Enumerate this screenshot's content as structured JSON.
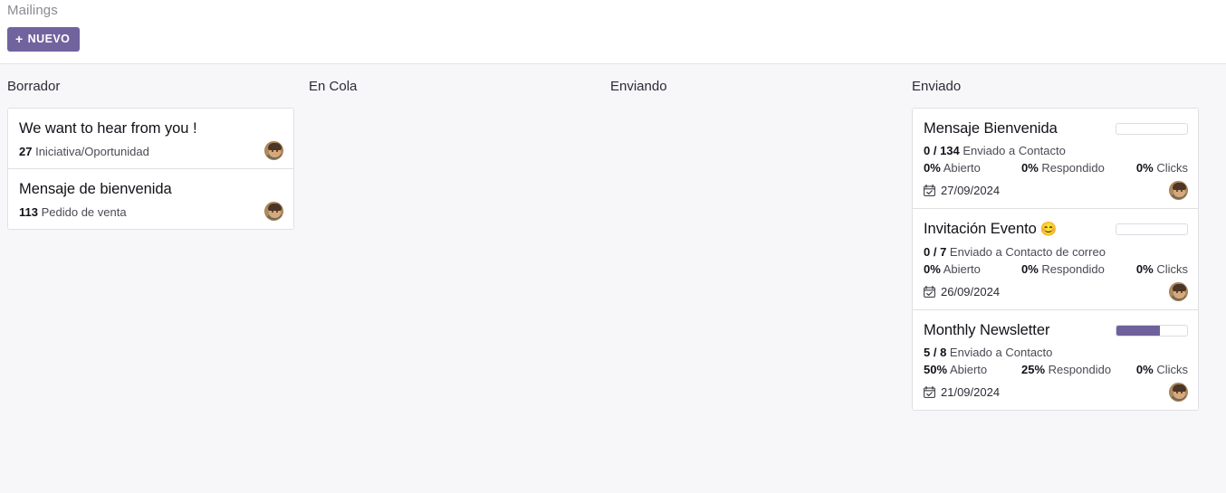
{
  "header": {
    "breadcrumb": "Mailings",
    "new_button_label": "NUEVO",
    "new_button_icon": "plus-icon",
    "accent_color": "#71639e"
  },
  "kanban": {
    "columns": [
      {
        "id": "borrador",
        "title": "Borrador",
        "cards": [
          {
            "title": "We want to hear from you !",
            "count": "27",
            "model": "Iniciativa/Oportunidad",
            "avatar": "user-avatar"
          },
          {
            "title": "Mensaje de bienvenida",
            "count": "113",
            "model": "Pedido de venta",
            "avatar": "user-avatar"
          }
        ]
      },
      {
        "id": "en-cola",
        "title": "En Cola",
        "cards": []
      },
      {
        "id": "enviando",
        "title": "Enviando",
        "cards": []
      },
      {
        "id": "enviado",
        "title": "Enviado",
        "cards": [
          {
            "title": "Mensaje Bienvenida",
            "emoji": "",
            "progress_percent": 0,
            "sent_count": "0 / 134",
            "sent_label": "Enviado a Contacto",
            "opened_value": "0%",
            "opened_label": "Abierto",
            "replied_value": "0%",
            "replied_label": "Respondido",
            "clicks_value": "0%",
            "clicks_label": "Clicks",
            "date": "27/09/2024",
            "date_icon": "calendar-check-icon",
            "avatar": "user-avatar"
          },
          {
            "title": "Invitación Evento",
            "emoji": "😊",
            "progress_percent": 0,
            "sent_count": "0 / 7",
            "sent_label": "Enviado a Contacto de correo",
            "opened_value": "0%",
            "opened_label": "Abierto",
            "replied_value": "0%",
            "replied_label": "Respondido",
            "clicks_value": "0%",
            "clicks_label": "Clicks",
            "date": "26/09/2024",
            "date_icon": "calendar-check-icon",
            "avatar": "user-avatar"
          },
          {
            "title": "Monthly Newsletter",
            "emoji": "",
            "progress_percent": 62,
            "sent_count": "5 / 8",
            "sent_label": "Enviado a Contacto",
            "opened_value": "50%",
            "opened_label": "Abierto",
            "replied_value": "25%",
            "replied_label": "Respondido",
            "clicks_value": "0%",
            "clicks_label": "Clicks",
            "date": "21/09/2024",
            "date_icon": "calendar-check-icon",
            "avatar": "user-avatar"
          }
        ]
      }
    ]
  }
}
